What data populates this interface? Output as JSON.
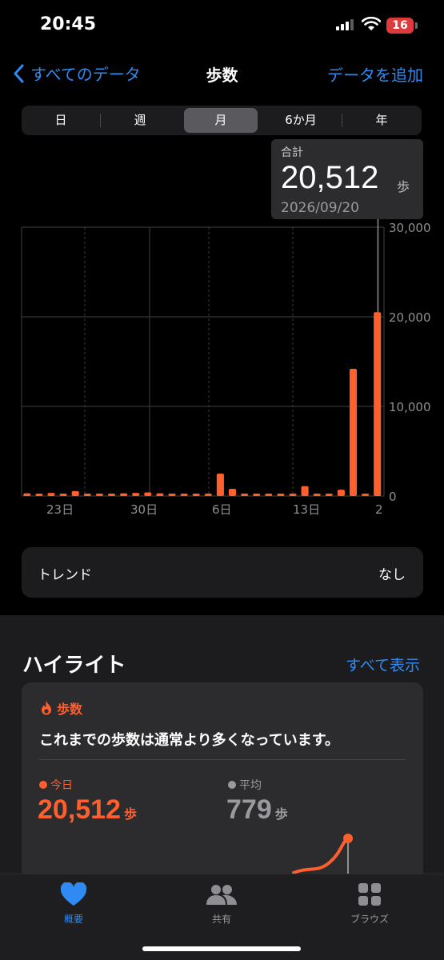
{
  "status_bar": {
    "time": "20:45",
    "battery": "16"
  },
  "nav": {
    "back_label": "すべてのデータ",
    "title": "歩数",
    "action_label": "データを追加"
  },
  "segments": [
    "日",
    "週",
    "月",
    "6か月",
    "年"
  ],
  "selected_segment": "月",
  "selection_tooltip": {
    "label": "合計",
    "value": "20,512",
    "unit": "歩",
    "date": "2026/09/20"
  },
  "chart_data": {
    "type": "bar",
    "x_tick_labels": [
      "23日",
      "30日",
      "6日",
      "13日",
      "2"
    ],
    "y_tick_labels": [
      "30,000",
      "20,000",
      "10,000",
      "0"
    ],
    "ylim": [
      0,
      30000
    ],
    "grid": true,
    "highlight_color": "#ff5e2d",
    "values": [
      300,
      150,
      350,
      200,
      550,
      250,
      200,
      150,
      300,
      350,
      400,
      300,
      200,
      250,
      200,
      200,
      2500,
      800,
      250,
      250,
      200,
      200,
      200,
      1100,
      200,
      250,
      700,
      14200,
      200,
      20512
    ]
  },
  "trend": {
    "label": "トレンド",
    "value": "なし"
  },
  "highlights": {
    "title": "ハイライト",
    "show_all": "すべて表示",
    "card": {
      "category": "歩数",
      "message": "これまでの歩数は通常より多くなっています。",
      "today_label": "今日",
      "today_value": "20,512",
      "today_unit": "歩",
      "avg_label": "平均",
      "avg_value": "779",
      "avg_unit": "歩"
    }
  },
  "tab_bar": {
    "items": [
      "概要",
      "共有",
      "ブラウズ"
    ]
  },
  "colors": {
    "accent": "#2f8bf3",
    "steps": "#ff5e2d"
  }
}
